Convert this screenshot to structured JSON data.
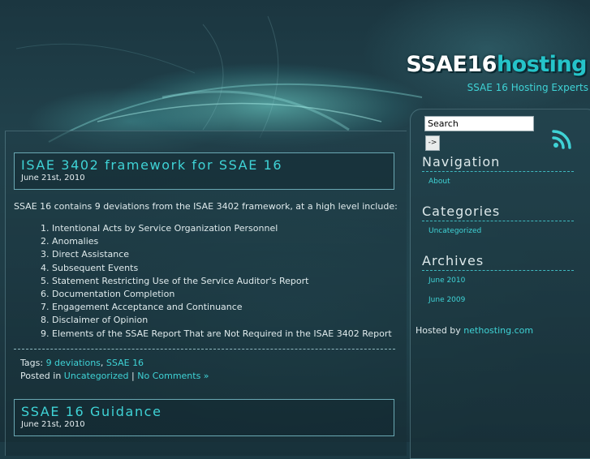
{
  "site": {
    "logo_main": "SSAE16",
    "logo_accent": "hosting",
    "tagline": "SSAE 16 Hosting Experts"
  },
  "search": {
    "value": "Search",
    "button_label": "->"
  },
  "posts": [
    {
      "title": "ISAE 3402 framework for SSAE 16",
      "date": "June 21st, 2010",
      "intro": "SSAE 16 contains 9 deviations from the ISAE 3402 framework, at a high level include:",
      "items": [
        "1. Intentional Acts by Service Organization Personnel",
        "2. Anomalies",
        "3. Direct Assistance",
        "4. Subsequent Events",
        "5. Statement Restricting Use of the Service Auditor's Report",
        "6. Documentation Completion",
        "7. Engagement Acceptance and Continuance",
        "8. Disclaimer of Opinion",
        "9. Elements of the SSAE Report That are Not Required in the ISAE 3402 Report"
      ],
      "tags_label": "Tags:",
      "tags": [
        "9 deviations",
        "SSAE 16"
      ],
      "posted_in_label": "Posted in",
      "category": "Uncategorized",
      "separator": "|",
      "comments": "No Comments »"
    },
    {
      "title": "SSAE 16 Guidance",
      "date": "June 21st, 2010"
    }
  ],
  "sidebar": {
    "navigation": {
      "heading": "Navigation",
      "links": [
        "About"
      ]
    },
    "categories": {
      "heading": "Categories",
      "links": [
        "Uncategorized"
      ]
    },
    "archives": {
      "heading": "Archives",
      "links": [
        "June 2010",
        "June 2009"
      ]
    },
    "hosted_by_label": "Hosted by",
    "hosted_by_link": "nethosting.com"
  },
  "icons": {
    "rss": "rss-icon"
  },
  "colors": {
    "accent": "#3fd3d6",
    "background": "#1c3a44"
  }
}
